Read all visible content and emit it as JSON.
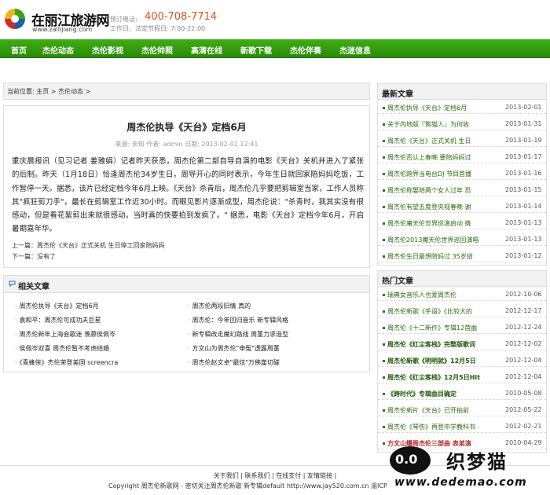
{
  "header": {
    "site_name": "在丽江旅游网",
    "site_url": "www.zailijiang.com",
    "phone_label": "预订电话:",
    "phone": "400-708-7714",
    "hours": "工作日、法定节假日: 7:00-22:00"
  },
  "nav": [
    "首页",
    "杰伦动态",
    "杰伦影视",
    "杰伦帅照",
    "高清在线",
    "新歌下载",
    "杰伦伴奏",
    "杰迷信息"
  ],
  "breadcrumb": "当前位置: 主页 > 杰伦动态 >",
  "article": {
    "title": "周杰伦执导《天台》定档6月",
    "meta": "来源: 未知   作者: admin   日期: 2013-02-01 12:41",
    "body": "重庆晨报讯（见习记者 姜雅娟）记者昨天获悉，周杰伦第二部自导自演的电影《天台》关机并进入了紧张的后制。昨天（1月18日）恰逢周杰伦34岁生日，周导开心的同时表示，今年生日就回家陪妈妈吃饭，工作暂停一天。据悉，该片已经定档今年6月上映。《天台》杀青后，周杰伦几乎要把剪辑室当家，工作人员称其\"疯狂剪刀手\"，最长在剪辑室工作近30小时。而眼见影片逐渐成型，周杰伦说：\"杀青时，我其实没有很感动，但是看花絮剪出来就很感动。当时真的快要拍到发疯了。\" 据悉，电影《天台》定档今年6月，开启暑期嘉年华。",
    "prev": "上一篇：周杰伦《天台》正式关机 生日停工回家陪妈妈",
    "next": "下一篇：没有了"
  },
  "related": {
    "title": "相关文章",
    "left": [
      "周杰伦执导《天台》定档6月",
      "袁和平：周杰伦可成功夫巨星",
      "周杰伦新年上海会歌迷 羡慕侯佩岑",
      "侯佩岑双喜 周杰伦暂不考虑结婚",
      "《青蜂侠》杰伦荣登美国 screencra"
    ],
    "right": [
      "周杰伦两段旧情 真的",
      "周杰伦：今年回归音乐 新专辑风格",
      "新专辑改走魔幻路线 周董力求造型",
      "方文山为周杰伦\"申冤\"透露周董",
      "周杰伦赵文卓\"最炫\"万佛崖切磋"
    ]
  },
  "latest": {
    "title": "最新文章",
    "items": [
      {
        "title": "周杰伦执导《天台》定档6月",
        "date": "2013-02-01"
      },
      {
        "title": "关于内地版『熊猫人』为何收",
        "date": "2013-01-31"
      },
      {
        "title": "周杰伦《天台》正式关机 生日",
        "date": "2013-01-19"
      },
      {
        "title": "周杰伦否认上春晚 要陪妈妈过",
        "date": "2013-01-17"
      },
      {
        "title": "周杰伦跨界当电台DJ 节目首播",
        "date": "2013-01-16"
      },
      {
        "title": "周杰伦称娶陪两个女人过年 恐",
        "date": "2013-01-15"
      },
      {
        "title": "周杰伦有望五度登央视春晚 谢",
        "date": "2013-01-14"
      },
      {
        "title": "周杰伦魔天伦世界巡演启动  携",
        "date": "2013-01-13"
      },
      {
        "title": "周杰伦2013魔天伦世界巡回演唱",
        "date": "2013-01-13"
      },
      {
        "title": "周杰伦生日最想陪妈过 35岁结",
        "date": "2013-01-12"
      }
    ]
  },
  "hot": {
    "title": "热门文章",
    "items": [
      {
        "title": "瑞典女音乐人也爱周杰伦",
        "date": "2012-10-06",
        "style": "normal"
      },
      {
        "title": "周杰伦新歌《手语》《比较大的",
        "date": "2012-12-17",
        "style": "normal"
      },
      {
        "title": "周杰伦《十二新作》专辑12首曲",
        "date": "2012-12-24",
        "style": "normal"
      },
      {
        "title": "周杰伦《红尘客栈》完整版歌词",
        "date": "2012-12-02",
        "style": "bold"
      },
      {
        "title": "周杰伦新歌《明明就》12月5日",
        "date": "2012-12-04",
        "style": "bold"
      },
      {
        "title": "周杰伦《红尘客栈》12月5日Hit",
        "date": "2012-12-04",
        "style": "bold"
      },
      {
        "title": "《跨时代》专辑曲目确定",
        "date": "2010-05-08",
        "style": "bold"
      },
      {
        "title": "周杰伦新片《天台》已开拍前",
        "date": "2012-05-22",
        "style": "normal"
      },
      {
        "title": "周杰伦《琴伤》再登中学教科书",
        "date": "2012-02-21",
        "style": "normal"
      },
      {
        "title": "方文山爆周杰伦三部曲 表弟演",
        "date": "2010-04-29",
        "style": "red"
      }
    ]
  },
  "footer": {
    "links": "关于我们 | 联系我们 | 在线支付 | 友情链接 |",
    "copyright": "Copyright 周杰伦新歌网 - 密切关注周杰伦新歌 新专辑default http://www.jay520.com.cn  渝ICP"
  },
  "watermark": {
    "face": "0.0",
    "brand": "织梦猫",
    "url": "www.dedemao.com"
  }
}
